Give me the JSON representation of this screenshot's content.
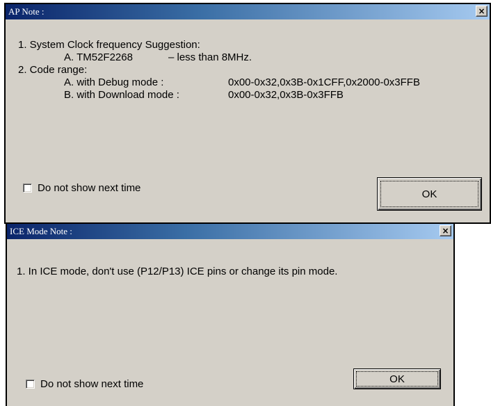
{
  "ap_note": {
    "title": "AP Note :",
    "close_glyph": "×",
    "line1": "1. System Clock frequency Suggestion:",
    "line1a_label": "A. TM52F2268",
    "line1a_value": "– less than 8MHz.",
    "line2": "2. Code range:",
    "line2a_label": "A. with Debug mode :",
    "line2a_value": "0x00-0x32,0x3B-0x1CFF,0x2000-0x3FFB",
    "line2b_label": "B. with Download mode :",
    "line2b_value": "0x00-0x32,0x3B-0x3FFB",
    "checkbox_label": "Do not show next time",
    "checkbox_checked": false,
    "ok_label": "OK"
  },
  "ice_note": {
    "title": "ICE Mode Note :",
    "close_glyph": "×",
    "line1": "1. In ICE mode, don't use (P12/P13) ICE pins or change its pin mode.",
    "checkbox_label": "Do not show next time",
    "checkbox_checked": false,
    "ok_label": "OK"
  },
  "colors": {
    "dialog_bg": "#d4d0c8",
    "titlebar_start": "#0a246a",
    "titlebar_end": "#a6caf0",
    "title_text": "#ffffff"
  }
}
